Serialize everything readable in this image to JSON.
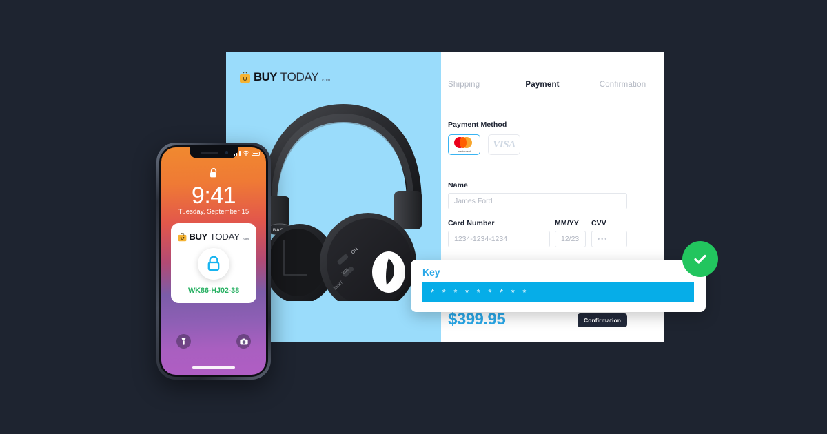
{
  "theme": {
    "background": "#1e2430",
    "product_panel_bg": "#9adcfb",
    "accent_blue": "#2aa8e8",
    "key_fill": "#06ade8",
    "success_green": "#22c55e",
    "code_green": "#27b062",
    "dark_button": "#22293a"
  },
  "brand": {
    "buy": "BUY",
    "today": "TODAY",
    "tld": ".com",
    "bag_icon": "smiley-shopping-bag-icon"
  },
  "checkout": {
    "product": {
      "image_alt": "black-over-ear-headphones",
      "badge_text": "BASS"
    },
    "tabs": [
      {
        "label": "Shipping",
        "active": false
      },
      {
        "label": "Payment",
        "active": true
      },
      {
        "label": "Confirmation",
        "active": false
      }
    ],
    "payment_method": {
      "label": "Payment Method",
      "options": [
        {
          "name": "Mastercard",
          "icon": "mastercard-icon",
          "caption": "mastercard",
          "selected": true
        },
        {
          "name": "Visa",
          "icon": "visa-icon",
          "caption": "VISA",
          "selected": false
        }
      ]
    },
    "fields": {
      "name_label": "Name",
      "name_value": "James Ford",
      "card_label": "Card Number",
      "card_value": "1234-1234-1234",
      "expiry_label": "MM/YY",
      "expiry_value": "12/23",
      "cvv_label": "CVV",
      "cvv_value": "•••"
    },
    "total_price": "$399.95",
    "submit_label": "Confirmation"
  },
  "key_overlay": {
    "title": "Key",
    "masked_value": "* * * * * * * * *"
  },
  "status_badge": {
    "icon": "checkmark-icon",
    "state": "success"
  },
  "phone": {
    "time": "9:41",
    "date": "Tuesday, September 15",
    "lock_icon": "unlocked-padlock-icon",
    "status_icons": [
      "cellular-signal-icon",
      "wifi-icon",
      "battery-icon"
    ],
    "notification": {
      "lock_icon": "padlock-icon",
      "code": "WK86-HJ02-38"
    },
    "quick_actions": [
      {
        "icon": "flashlight-icon"
      },
      {
        "icon": "camera-icon"
      }
    ]
  }
}
